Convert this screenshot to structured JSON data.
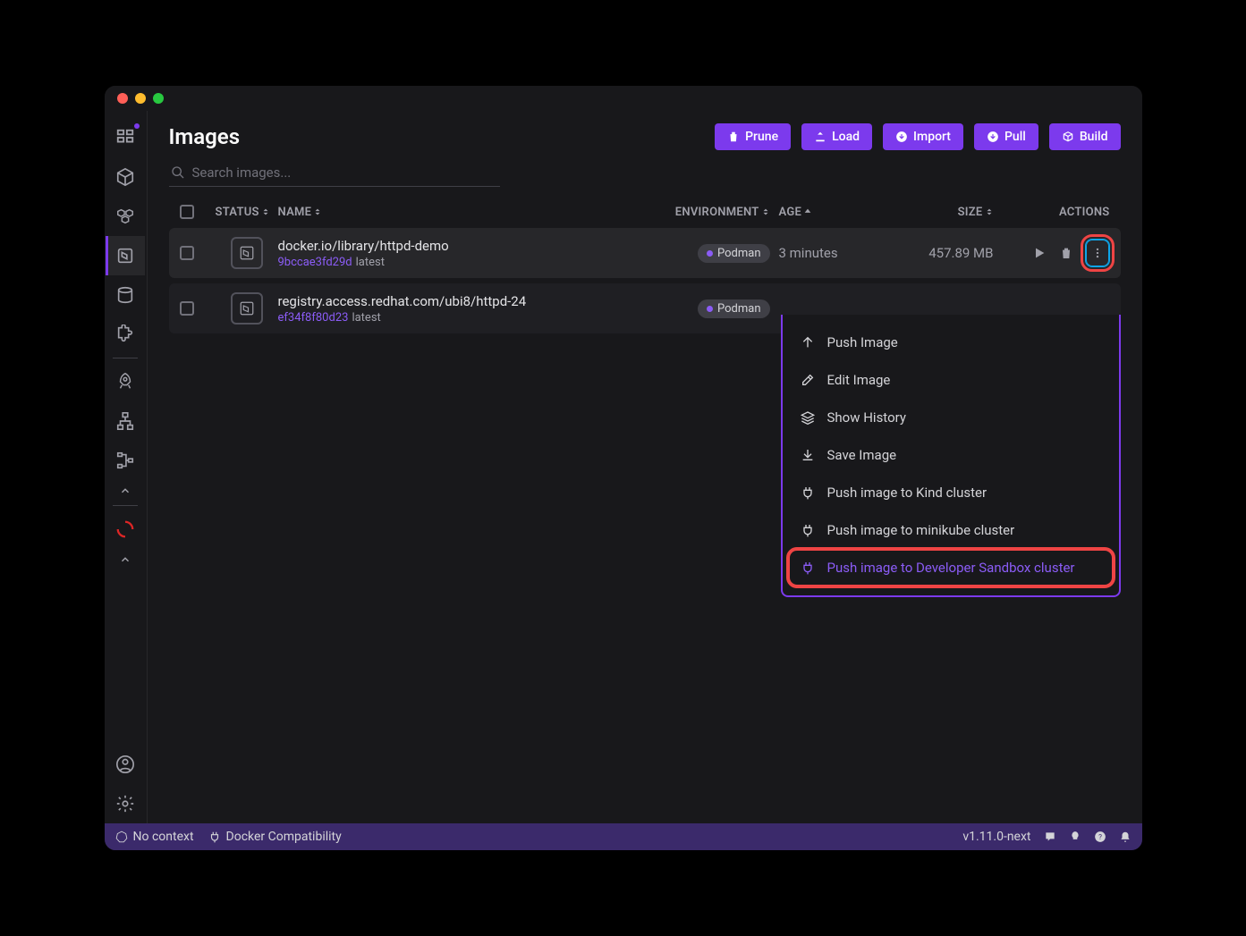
{
  "page": {
    "title": "Images"
  },
  "toolbar": {
    "prune": "Prune",
    "load": "Load",
    "import": "Import",
    "pull": "Pull",
    "build": "Build"
  },
  "search": {
    "placeholder": "Search images..."
  },
  "columns": {
    "status": "STATUS",
    "name": "NAME",
    "environment": "ENVIRONMENT",
    "age": "AGE",
    "size": "SIZE",
    "actions": "ACTIONS"
  },
  "images": [
    {
      "name": "docker.io/library/httpd-demo",
      "hash": "9bccae3fd29d",
      "tag": "latest",
      "env": "Podman",
      "age": "3 minutes",
      "size": "457.89 MB"
    },
    {
      "name": "registry.access.redhat.com/ubi8/httpd-24",
      "hash": "ef34f8f80d23",
      "tag": "latest",
      "env": "Podman",
      "age": "",
      "size": ""
    }
  ],
  "menu": {
    "push_image": "Push Image",
    "edit_image": "Edit Image",
    "show_history": "Show History",
    "save_image": "Save Image",
    "push_kind": "Push image to Kind cluster",
    "push_minikube": "Push image to minikube cluster",
    "push_sandbox": "Push image to Developer Sandbox cluster"
  },
  "statusbar": {
    "context": "No context",
    "docker_compat": "Docker Compatibility",
    "version": "v1.11.0-next"
  }
}
